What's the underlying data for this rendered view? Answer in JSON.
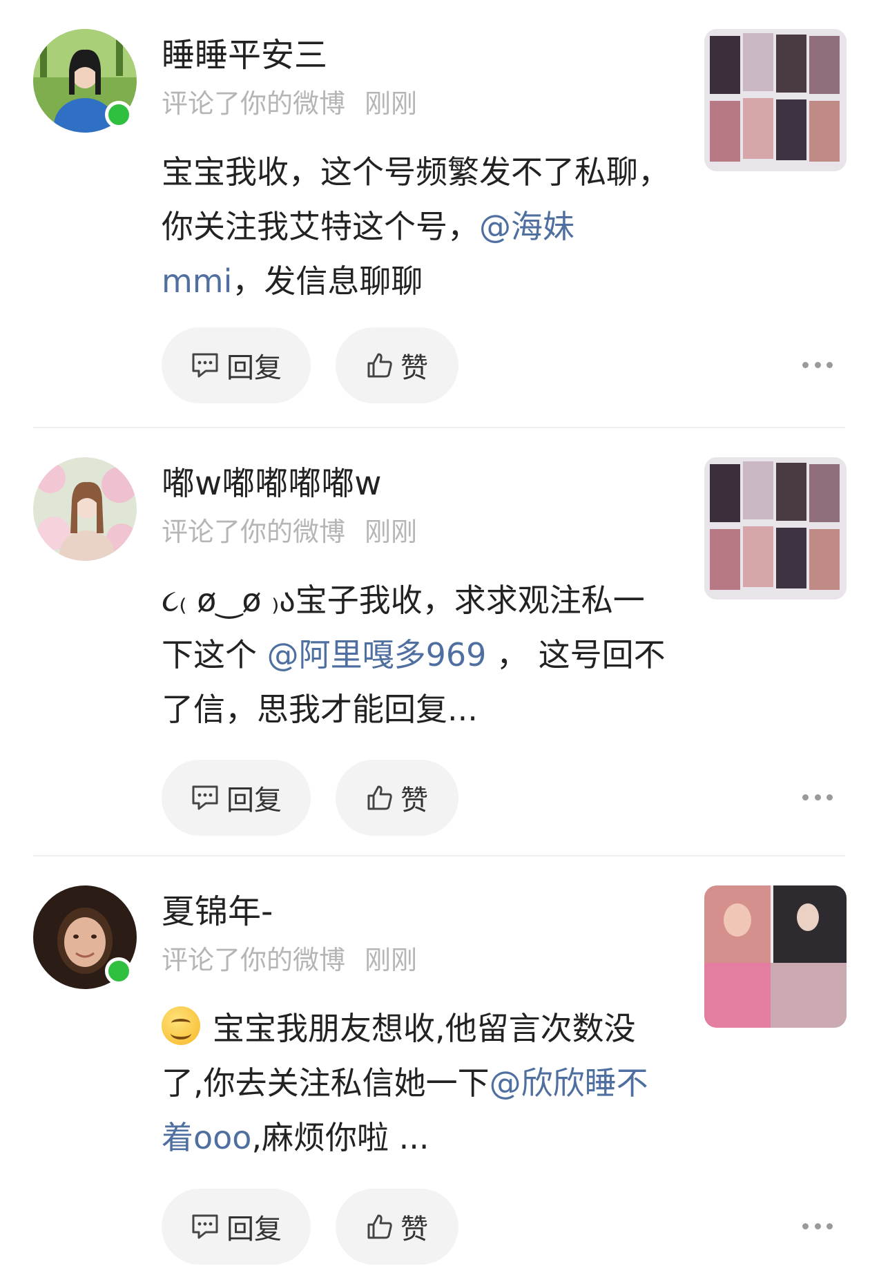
{
  "actions": {
    "reply_label": "回复",
    "like_label": "赞"
  },
  "comments": [
    {
      "name": "睡睡平安三",
      "meta": "评论了你的微博",
      "time": "刚刚",
      "online": true,
      "text_before": "宝宝我收，这个号频繁发不了私聊，你关注我艾特这个号，",
      "mention": "@海妹mmi",
      "text_after": "，发信息聊聊"
    },
    {
      "name": "嘟w嘟嘟嘟嘟w",
      "meta": "评论了你的微博",
      "time": "刚刚",
      "online": false,
      "text_before": "૮₍ ø‿ø ₎ა宝子我收，求求观注私一下这个 ",
      "mention": "@阿里嘎多969",
      "text_after": " ， 这号回不了信，思我才能回复..."
    },
    {
      "name": "夏锦年-",
      "meta": "评论了你的微博",
      "time": "刚刚",
      "online": true,
      "emoji": "smiling-face",
      "text_before": "宝宝我朋友想收,他留言次数没了,你去关注私信她一下",
      "mention": "@欣欣睡不着ooo",
      "text_after": ",麻烦你啦 ..."
    }
  ],
  "colors": {
    "mention": "#4e6f9f",
    "online": "#2fc03f",
    "meta": "#b5b5b5",
    "button_bg": "#f3f3f3"
  }
}
